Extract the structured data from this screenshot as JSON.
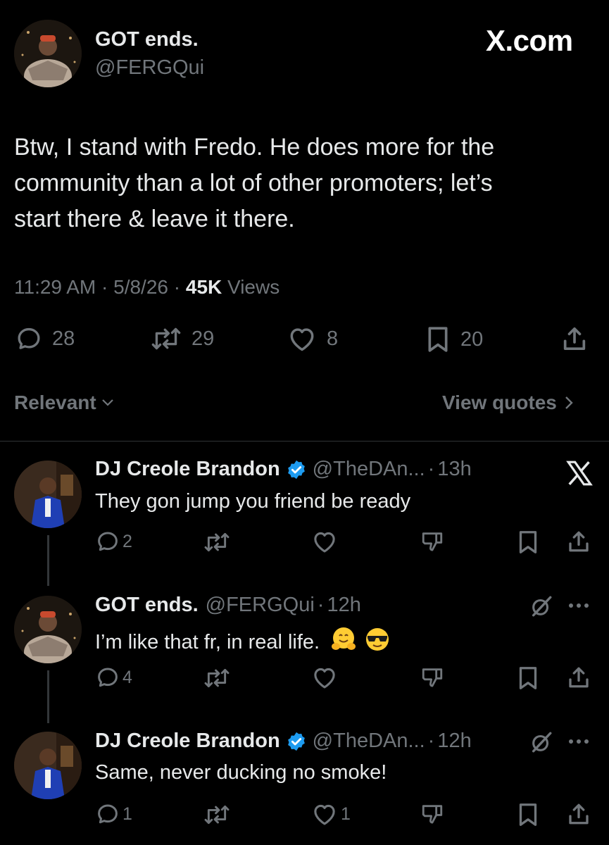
{
  "site_watermark": "X.com",
  "main_tweet": {
    "display_name": "GOT ends.",
    "handle": "@FERGQui",
    "text_lines": [
      "Btw, I stand with Fredo. He does more for the",
      "community than a lot of other promoters; let’s",
      "start there & leave it there."
    ],
    "time": "11:29 AM",
    "date": "5/8/26",
    "views_count": "45K",
    "views_label": "Views",
    "separator": "·",
    "replies": "28",
    "reposts": "29",
    "likes": "8",
    "bookmarks": "20"
  },
  "filter_bar": {
    "sort_label": "Relevant",
    "view_quotes_label": "View quotes"
  },
  "replies": [
    {
      "display_name": "DJ Creole Brandon",
      "handle": "@TheDAn...",
      "time": "13h",
      "text": "They gon jump you friend be ready",
      "replies": "2",
      "likes": ""
    },
    {
      "display_name": "GOT ends.",
      "handle": "@FERGQui",
      "time": "12h",
      "text": "I’m like that fr, in real life.",
      "replies": "4",
      "likes": ""
    },
    {
      "display_name": "DJ Creole Brandon",
      "handle": "@TheDAn...",
      "time": "12h",
      "text": "Same, never ducking no smoke!",
      "replies": "1",
      "likes": "1"
    }
  ],
  "colors": {
    "background": "#000000",
    "text": "#e7e9ea",
    "secondary": "#71767b",
    "verified": "#1d9bf0",
    "divider": "#2f3336"
  },
  "icons": [
    "reply-icon",
    "repost-icon",
    "like-icon",
    "bookmark-icon",
    "share-icon",
    "downvote-icon",
    "grok-icon",
    "more-icon",
    "x-logo-icon",
    "verified-badge-icon",
    "chevron-down-icon",
    "chevron-right-icon"
  ]
}
